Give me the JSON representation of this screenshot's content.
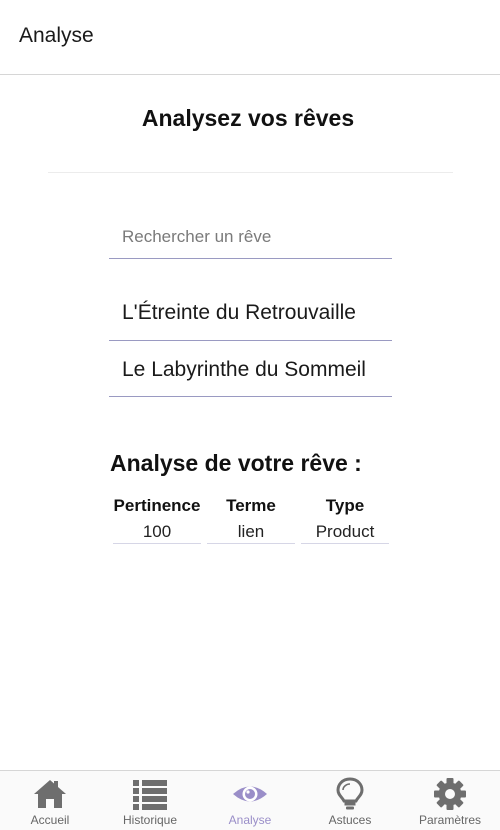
{
  "header": {
    "title": "Analyse"
  },
  "main": {
    "title": "Analysez vos rêves",
    "search": {
      "placeholder": "Rechercher un rêve",
      "value": ""
    },
    "dreams": [
      {
        "title": "L'Étreinte du Retrouvaille"
      },
      {
        "title": "Le Labyrinthe du Sommeil"
      }
    ]
  },
  "analysis": {
    "title": "Analyse de votre rêve :",
    "columns": [
      "Pertinence",
      "Terme",
      "Type"
    ],
    "rows": [
      {
        "pertinence": "100",
        "terme": "lien",
        "type": "Product"
      }
    ]
  },
  "nav": {
    "items": [
      {
        "label": "Accueil",
        "icon": "home-icon",
        "active": false
      },
      {
        "label": "Historique",
        "icon": "list-icon",
        "active": false
      },
      {
        "label": "Analyse",
        "icon": "eye-icon",
        "active": true
      },
      {
        "label": "Astuces",
        "icon": "lightbulb-icon",
        "active": false
      },
      {
        "label": "Paramètres",
        "icon": "gear-icon",
        "active": false
      }
    ],
    "colors": {
      "inactive": "#6e6e6e",
      "active": "#9a8ec8"
    }
  }
}
